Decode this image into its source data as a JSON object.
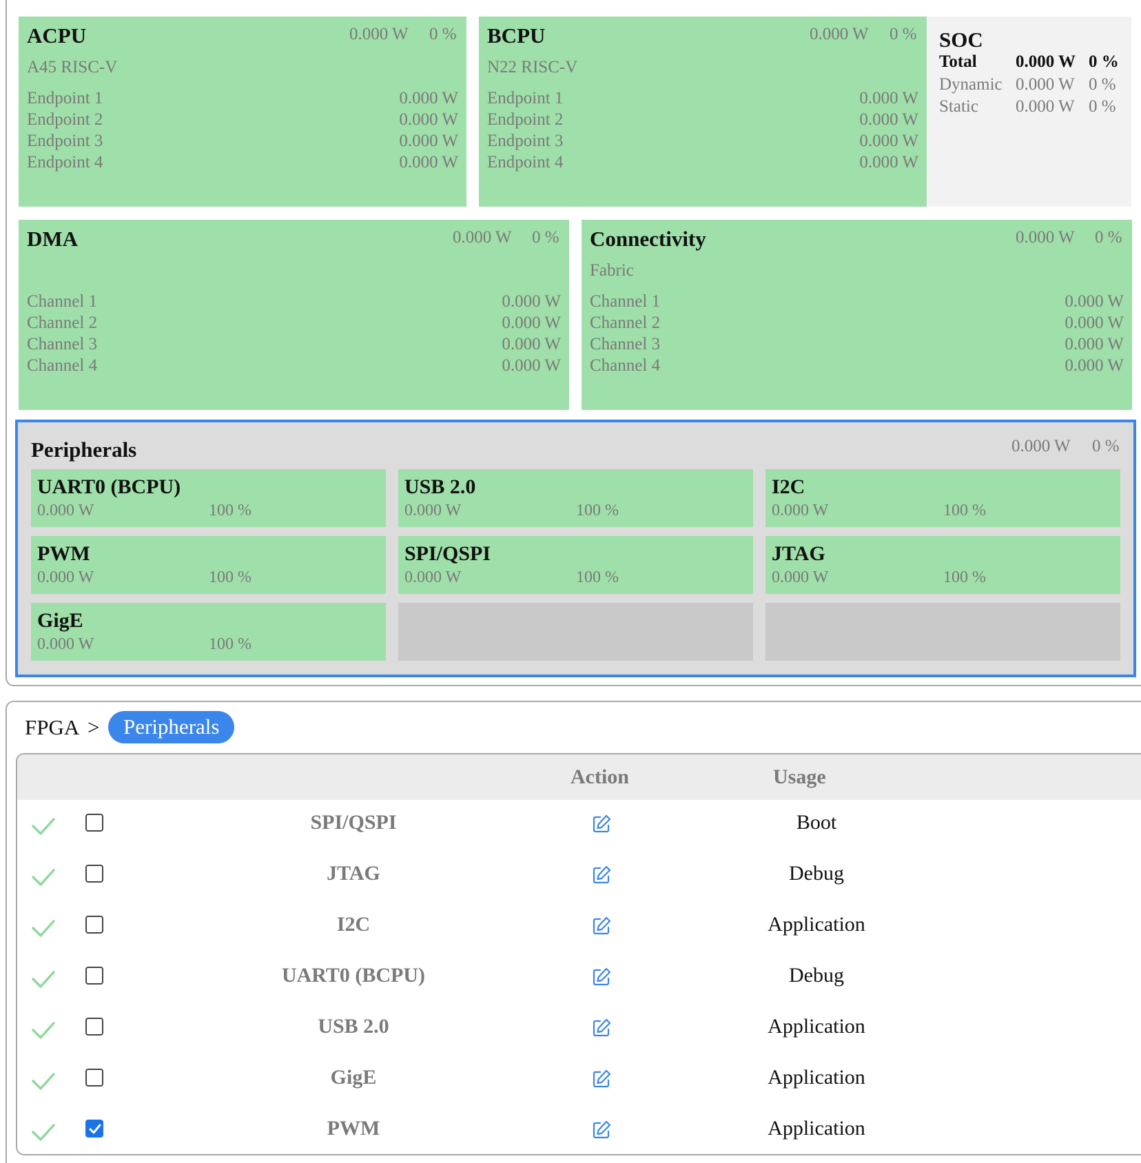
{
  "acpu": {
    "title": "ACPU",
    "power": "0.000 W",
    "percent": "0 %",
    "subtitle": "A45 RISC-V",
    "items": [
      {
        "label": "Endpoint 1",
        "value": "0.000 W"
      },
      {
        "label": "Endpoint 2",
        "value": "0.000 W"
      },
      {
        "label": "Endpoint 3",
        "value": "0.000 W"
      },
      {
        "label": "Endpoint 4",
        "value": "0.000 W"
      }
    ]
  },
  "bcpu": {
    "title": "BCPU",
    "power": "0.000 W",
    "percent": "0 %",
    "subtitle": "N22 RISC-V",
    "items": [
      {
        "label": "Endpoint 1",
        "value": "0.000 W"
      },
      {
        "label": "Endpoint 2",
        "value": "0.000 W"
      },
      {
        "label": "Endpoint 3",
        "value": "0.000 W"
      },
      {
        "label": "Endpoint 4",
        "value": "0.000 W"
      }
    ]
  },
  "soc": {
    "title": "SOC",
    "rows": [
      {
        "label": "Total",
        "value": "0.000 W",
        "percent": "0 %"
      },
      {
        "label": "Dynamic",
        "value": "0.000 W",
        "percent": "0 %"
      },
      {
        "label": "Static",
        "value": "0.000 W",
        "percent": "0 %"
      }
    ]
  },
  "dma": {
    "title": "DMA",
    "power": "0.000 W",
    "percent": "0 %",
    "items": [
      {
        "label": "Channel 1",
        "value": "0.000 W"
      },
      {
        "label": "Channel 2",
        "value": "0.000 W"
      },
      {
        "label": "Channel 3",
        "value": "0.000 W"
      },
      {
        "label": "Channel 4",
        "value": "0.000 W"
      }
    ]
  },
  "connectivity": {
    "title": "Connectivity",
    "power": "0.000 W",
    "percent": "0 %",
    "subtitle": "Fabric",
    "items": [
      {
        "label": "Channel 1",
        "value": "0.000 W"
      },
      {
        "label": "Channel 2",
        "value": "0.000 W"
      },
      {
        "label": "Channel 3",
        "value": "0.000 W"
      },
      {
        "label": "Channel 4",
        "value": "0.000 W"
      }
    ]
  },
  "peripherals": {
    "title": "Peripherals",
    "power": "0.000 W",
    "percent": "0 %",
    "tiles": [
      {
        "name": "UART0 (BCPU)",
        "power": "0.000 W",
        "percent": "100 %"
      },
      {
        "name": "USB 2.0",
        "power": "0.000 W",
        "percent": "100 %"
      },
      {
        "name": "I2C",
        "power": "0.000 W",
        "percent": "100 %"
      },
      {
        "name": "PWM",
        "power": "0.000 W",
        "percent": "100 %"
      },
      {
        "name": "SPI/QSPI",
        "power": "0.000 W",
        "percent": "100 %"
      },
      {
        "name": "JTAG",
        "power": "0.000 W",
        "percent": "100 %"
      },
      {
        "name": "GigE",
        "power": "0.000 W",
        "percent": "100 %"
      }
    ]
  },
  "breadcrumb": {
    "root": "FPGA",
    "separator": ">",
    "current": "Peripherals"
  },
  "table": {
    "headers": {
      "action": "Action",
      "usage": "Usage"
    },
    "rows": [
      {
        "name": "SPI/QSPI",
        "usage": "Boot",
        "checked": false
      },
      {
        "name": "JTAG",
        "usage": "Debug",
        "checked": false
      },
      {
        "name": "I2C",
        "usage": "Application",
        "checked": false
      },
      {
        "name": "UART0 (BCPU)",
        "usage": "Debug",
        "checked": false
      },
      {
        "name": "USB 2.0",
        "usage": "Application",
        "checked": false
      },
      {
        "name": "GigE",
        "usage": "Application",
        "checked": false
      },
      {
        "name": "PWM",
        "usage": "Application",
        "checked": true
      }
    ]
  },
  "colors": {
    "block_green": "#9fdfa9",
    "selection_blue": "#3b86ea",
    "check_green": "#8fd99a",
    "checkbox_blue": "#1a73e8"
  },
  "icons": {
    "status": "check-icon",
    "action": "edit-icon"
  }
}
